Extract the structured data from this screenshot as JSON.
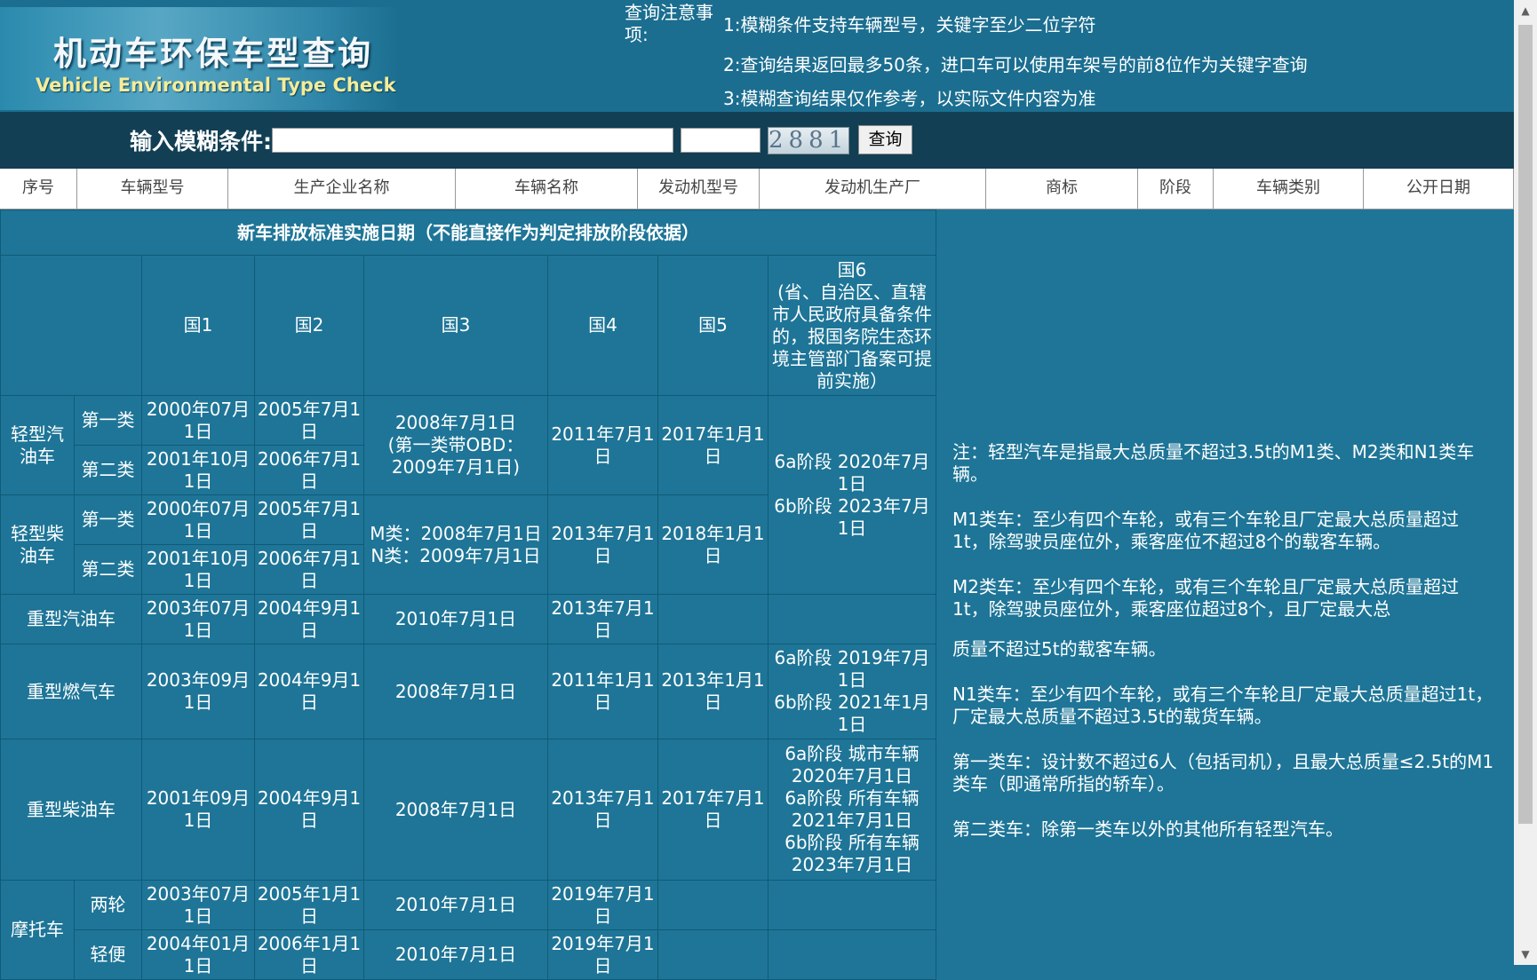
{
  "header": {
    "logo_cn": "机动车环保车型查询",
    "logo_en": "Vehicle Environmental Type Check",
    "notice_title": "查询注意事项:",
    "notices": [
      "1:模糊条件支持车辆型号，关键字至少二位字符",
      "2:查询结果返回最多50条，进口车可以使用车架号的前8位作为关键字查询",
      "3:模糊查询结果仅作参考，以实际文件内容为准"
    ]
  },
  "search": {
    "label": "输入模糊条件:",
    "keyword_value": "",
    "captcha_value": "",
    "captcha_image_text": "2881",
    "button": "查询"
  },
  "result_columns": [
    "序号",
    "车辆型号",
    "生产企业名称",
    "车辆名称",
    "发动机型号",
    "发动机生产厂",
    "商标",
    "阶段",
    "车辆类别",
    "公开日期"
  ],
  "standards": {
    "title": "新车排放标准实施日期（不能直接作为判定排放阶段依据）",
    "headers": [
      "国1",
      "国2",
      "国3",
      "国4",
      "国5",
      "国6\n(省、自治区、直辖市人民政府具备条件的，报国务院生态环境主管部门备案可提前实施）"
    ],
    "light_gasoline": {
      "name": "轻型汽油车",
      "class1": {
        "name": "第一类",
        "g1": "2000年07月1日",
        "g2": "2005年7月1日"
      },
      "class2": {
        "name": "第二类",
        "g1": "2001年10月1日",
        "g2": "2006年7月1日"
      },
      "g3": "2008年7月1日\n(第一类带OBD：2009年7月1日)",
      "g4": "2011年7月1日",
      "g5": "2017年1月1日"
    },
    "light_g6": "6a阶段 2020年7月1日\n6b阶段 2023年7月1日",
    "light_diesel": {
      "name": "轻型柴油车",
      "class1": {
        "name": "第一类",
        "g1": "2000年07月1日",
        "g2": "2005年7月1日"
      },
      "class2": {
        "name": "第二类",
        "g1": "2001年10月1日",
        "g2": "2006年7月1日"
      },
      "g3": "M类：2008年7月1日\nN类：2009年7月1日",
      "g4": "2013年7月1日",
      "g5": "2018年1月1日"
    },
    "heavy_gasoline": {
      "name": "重型汽油车",
      "g1": "2003年07月1日",
      "g2": "2004年9月1日",
      "g3": "2010年7月1日",
      "g4": "2013年7月1日",
      "g5": "",
      "g6": ""
    },
    "heavy_gas": {
      "name": "重型燃气车",
      "g1": "2003年09月1日",
      "g2": "2004年9月1日",
      "g3": "2008年7月1日",
      "g4": "2011年1月1日",
      "g5": "2013年1月1日",
      "g6": "6a阶段 2019年7月1日\n6b阶段 2021年1月1日"
    },
    "heavy_diesel": {
      "name": "重型柴油车",
      "g1": "2001年09月1日",
      "g2": "2004年9月1日",
      "g3": "2008年7月1日",
      "g4": "2013年7月1日",
      "g5": "2017年7月1日",
      "g6": "6a阶段 城市车辆\n2020年7月1日\n6a阶段 所有车辆\n2021年7月1日\n6b阶段 所有车辆\n2023年7月1日"
    },
    "motorcycle": {
      "name": "摩托车",
      "two": {
        "name": "两轮",
        "g1": "2003年07月1日",
        "g2": "2005年1月1日",
        "g3": "2010年7月1日",
        "g4": "2019年7月1日"
      },
      "light": {
        "name": "轻便",
        "g1": "2004年01月1日",
        "g2": "2006年1月1日",
        "g3": "2010年7月1日",
        "g4": "2019年7月1日"
      }
    }
  },
  "notes": [
    "注：轻型汽车是指最大总质量不超过3.5t的M1类、M2类和N1类车辆。",
    "M1类车：至少有四个车轮，或有三个车轮且厂定最大总质量超过1t，除驾驶员座位外，乘客座位不超过8个的载客车辆。",
    "M2类车：至少有四个车轮，或有三个车轮且厂定最大总质量超过1t，除驾驶员座位外，乘客座位超过8个，且厂定最大总",
    "质量不超过5t的载客车辆。",
    "N1类车：至少有四个车轮，或有三个车轮且厂定最大总质量超过1t，厂定最大总质量不超过3.5t的载货车辆。",
    "第一类车：设计数不超过6人（包括司机），且最大总质量≤2.5t的M1类车（即通常所指的轿车）。",
    "第二类车：除第一类车以外的其他所有轻型汽车。"
  ]
}
